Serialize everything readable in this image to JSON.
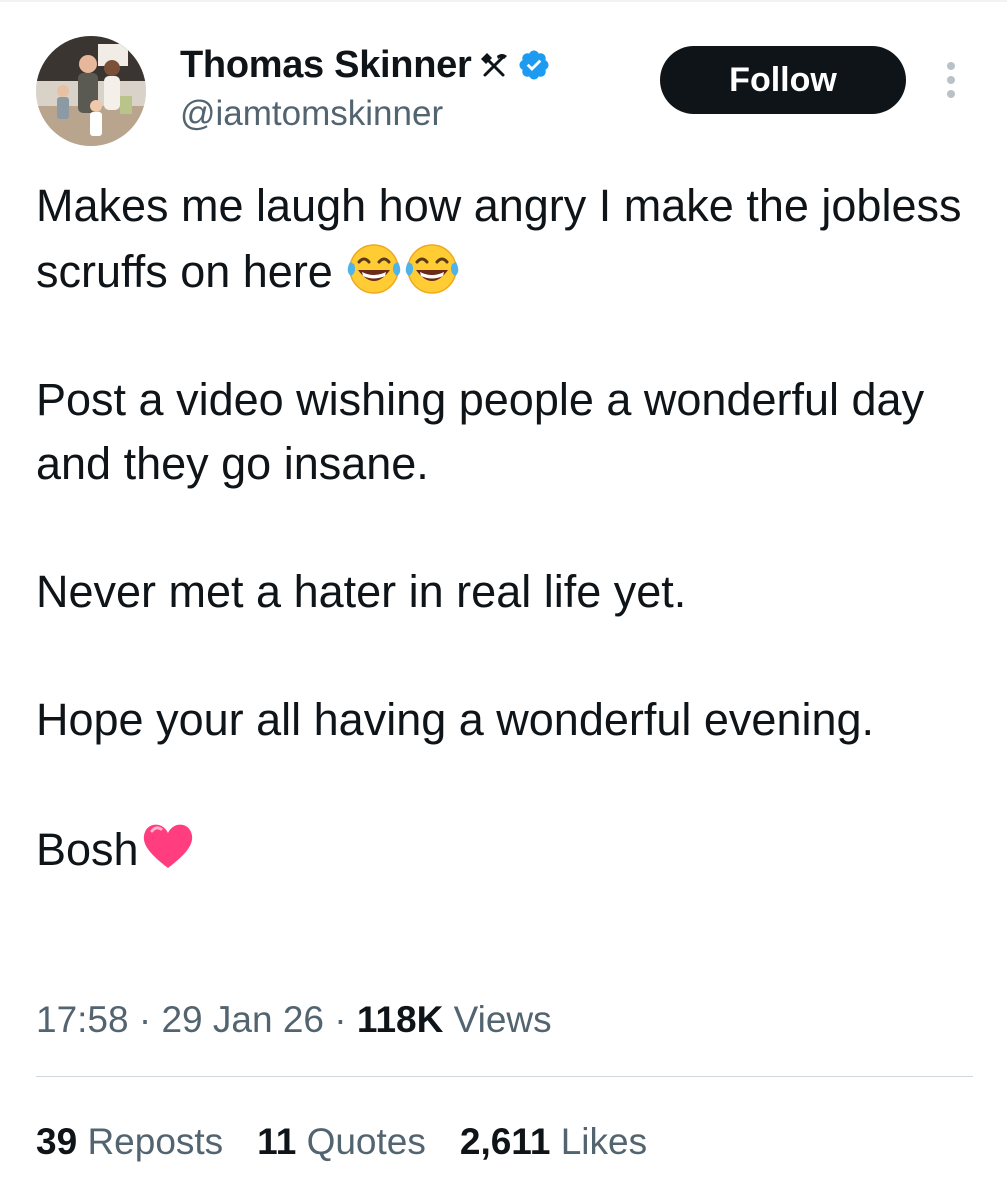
{
  "author": {
    "display_name": "Thomas Skinner",
    "handle": "@iamtomskinner",
    "name_badge_icon": "hammer-and-pick-icon",
    "verified_icon": "verified-badge-icon",
    "verified_color": "#1d9bf0"
  },
  "header": {
    "follow_label": "Follow",
    "more_icon": "vertical-ellipsis-icon"
  },
  "tweet": {
    "lines": [
      "Makes me laugh how angry I make the jobless scruffs on here",
      "Post a video wishing people a wonderful day and they go insane.",
      "Never met a hater in real life yet.",
      "Hope your all having a wonderful evening.",
      "Bosh"
    ],
    "emoji_after_line_1": [
      "face-with-tears-of-joy",
      "face-with-tears-of-joy"
    ],
    "emoji_after_line_5": [
      "red-heart"
    ]
  },
  "meta": {
    "time": "17:58",
    "separator": "·",
    "date": "29 Jan 26",
    "views_count": "118K",
    "views_label": "Views"
  },
  "stats": {
    "reposts_count": "39",
    "reposts_label": "Reposts",
    "quotes_count": "11",
    "quotes_label": "Quotes",
    "likes_count": "2,611",
    "likes_label": "Likes"
  },
  "colors": {
    "text_primary": "#0f1419",
    "text_secondary": "#536471",
    "follow_button_bg": "#0f1419",
    "divider": "#cfd9de"
  }
}
